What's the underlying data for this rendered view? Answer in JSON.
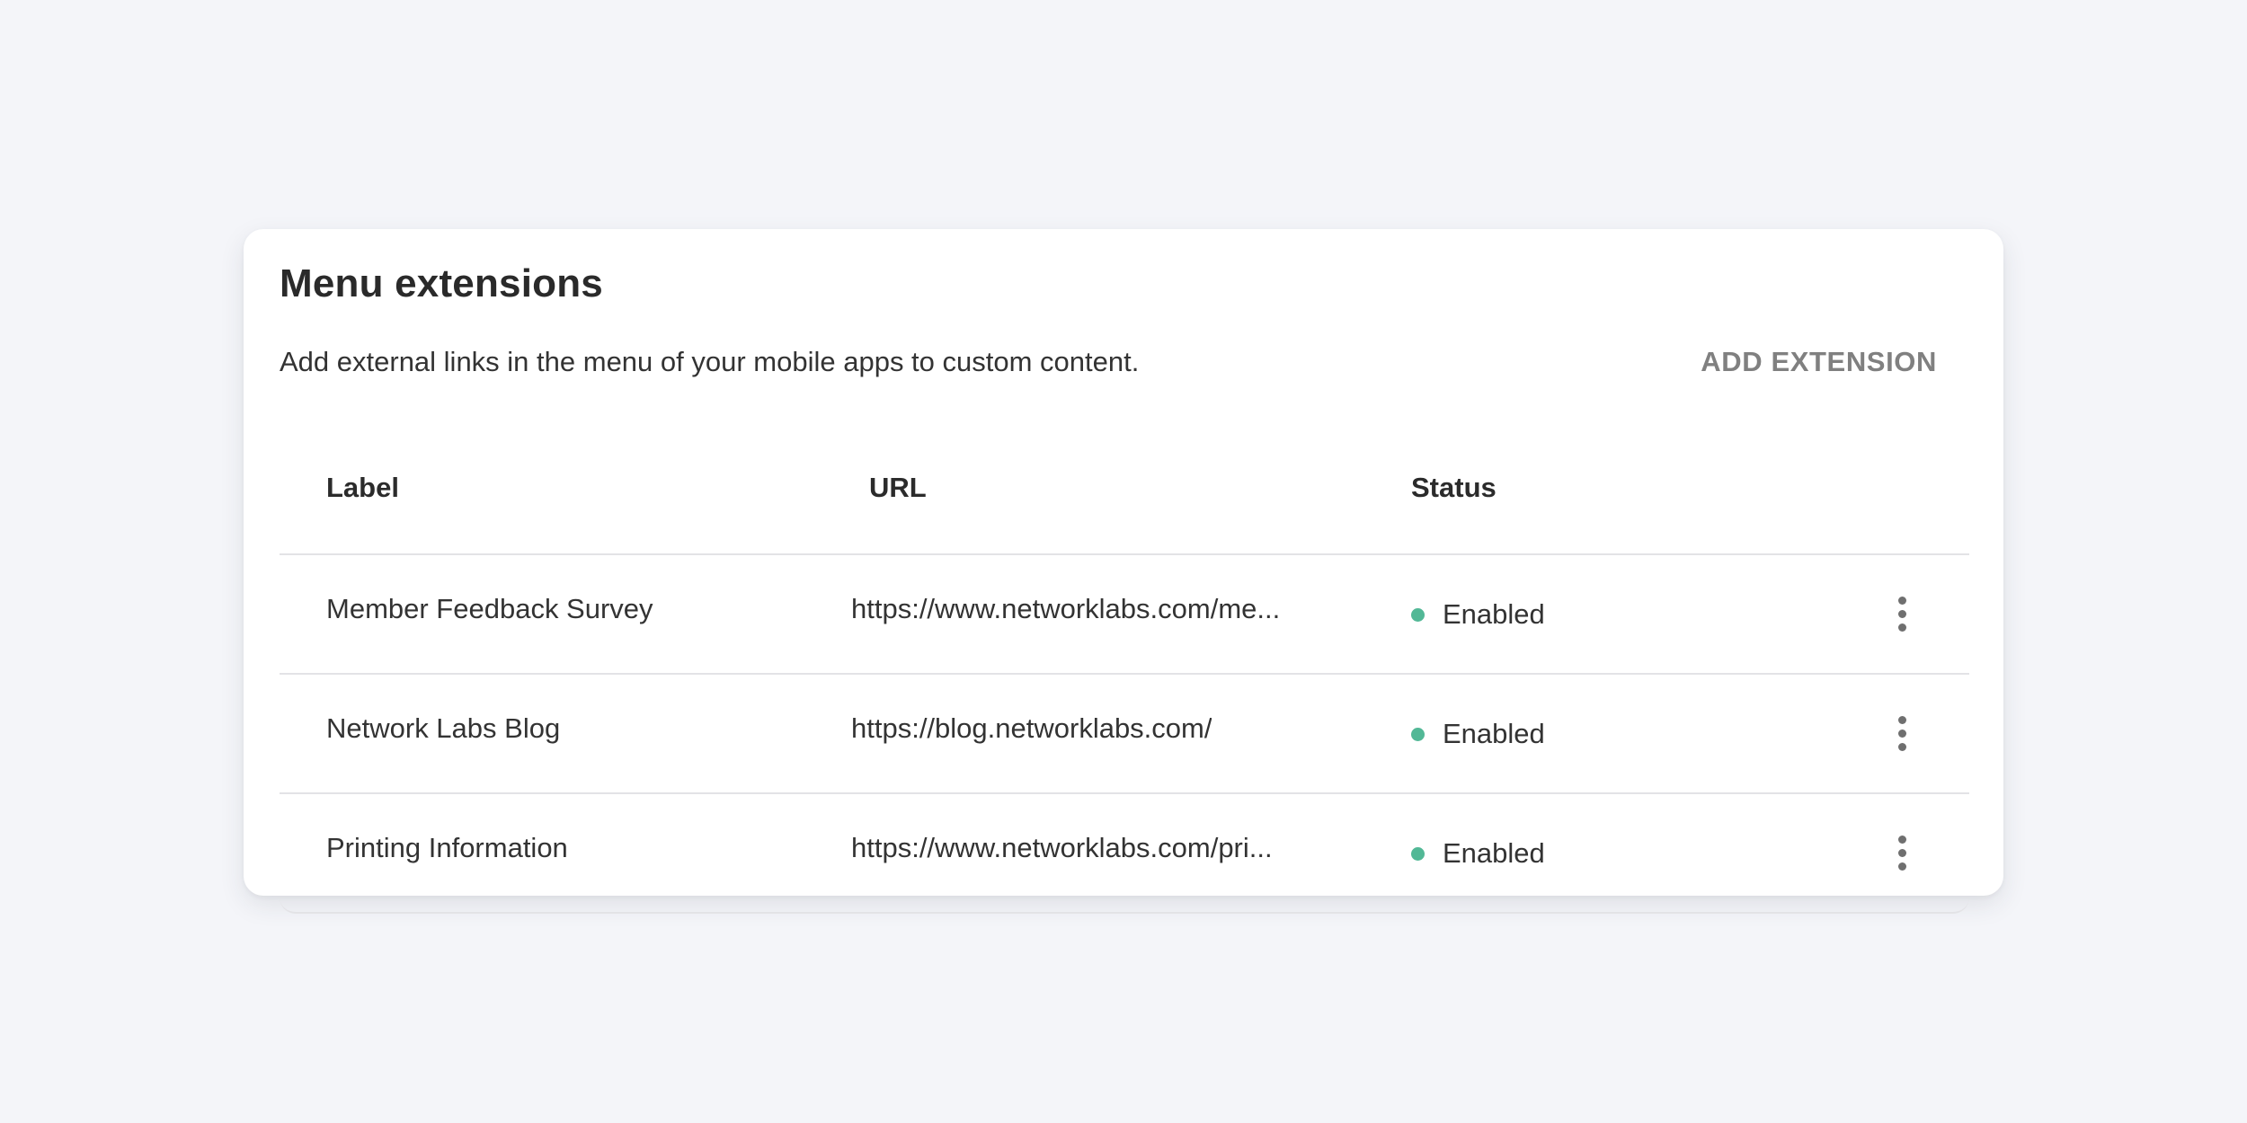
{
  "card": {
    "title": "Menu extensions",
    "description": "Add external links in the menu of your mobile apps to custom content.",
    "add_button_label": "ADD EXTENSION"
  },
  "table": {
    "headers": {
      "label": "Label",
      "url": "URL",
      "status": "Status"
    },
    "rows": [
      {
        "label": "Member Feedback Survey",
        "url": "https://www.networklabs.com/me...",
        "status": "Enabled",
        "menu_icon": "more-vertical-icon"
      },
      {
        "label": "Network Labs Blog",
        "url": "https://blog.networklabs.com/",
        "status": "Enabled",
        "menu_icon": "more-vertical-icon"
      },
      {
        "label": "Printing Information",
        "url": "https://www.networklabs.com/pri...",
        "status": "Enabled",
        "menu_icon": "more-vertical-icon"
      }
    ]
  },
  "colors": {
    "page_background": "#f4f5f9",
    "card_background": "#ffffff",
    "status_enabled": "#52b896",
    "action_text": "#808080"
  }
}
